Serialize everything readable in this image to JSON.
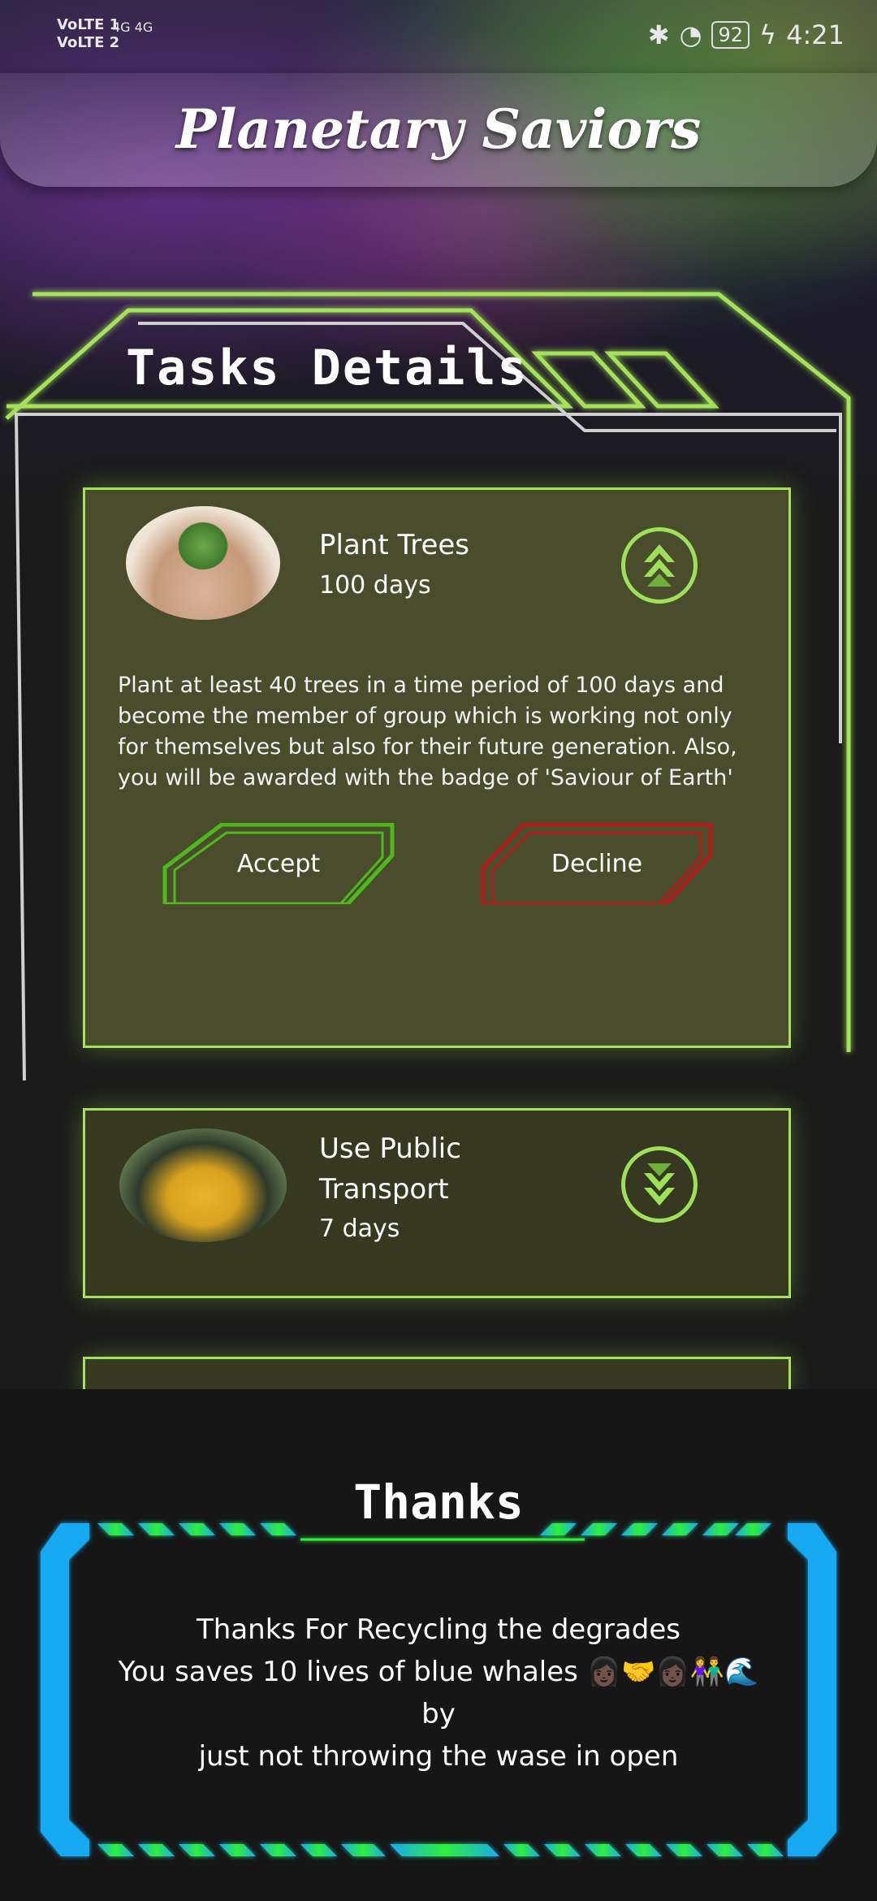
{
  "status_bar": {
    "network1": "VoLTE 1",
    "network2": "VoLTE 2",
    "signal": "4G 4G",
    "battery": "92",
    "time": "4:21"
  },
  "header": {
    "title": "Planetary Saviors"
  },
  "tasks_section": {
    "title": "Tasks Details",
    "tasks": [
      {
        "name": "Plant Trees",
        "duration": "100 days",
        "description": "Plant at least 40 trees in a time period of 100 days and become the member of group which is working not only for themselves but also for their future generation. Also, you will be awarded with the badge of 'Saviour of Earth'",
        "accept_label": "Accept",
        "decline_label": "Decline",
        "icon": "chevron-up-icon"
      },
      {
        "name": "Use Public Transport",
        "duration": "7 days",
        "icon": "chevron-down-icon"
      }
    ]
  },
  "thanks": {
    "title": "Thanks",
    "line1": "Thanks For Recycling the degrades",
    "line2": "You saves 10 lives of blue whales 👩🏿🤝👩🏿👫🌊 by",
    "line3": "just not throwing the wase in open"
  },
  "colors": {
    "accent_green": "#a4e25a",
    "decline_red": "#b01a1a",
    "frame_blue": "#1ab0f0"
  }
}
